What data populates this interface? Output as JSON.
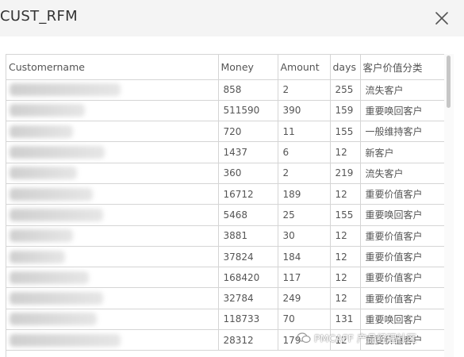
{
  "window": {
    "title": "CUST_RFM",
    "close_icon": "close-icon"
  },
  "table": {
    "headers": {
      "name": "Customername",
      "money": "Money",
      "amount": "Amount",
      "days": "days",
      "segment": "客户价值分类"
    },
    "rows": [
      {
        "money": "858",
        "amount": "2",
        "days": "255",
        "segment": "流失客户"
      },
      {
        "money": "511590",
        "amount": "390",
        "days": "159",
        "segment": "重要唤回客户"
      },
      {
        "money": "720",
        "amount": "11",
        "days": "155",
        "segment": "一般维持客户"
      },
      {
        "money": "1437",
        "amount": "6",
        "days": "12",
        "segment": "新客户"
      },
      {
        "money": "360",
        "amount": "2",
        "days": "219",
        "segment": "流失客户"
      },
      {
        "money": "16712",
        "amount": "189",
        "days": "12",
        "segment": "重要价值客户"
      },
      {
        "money": "5468",
        "amount": "25",
        "days": "155",
        "segment": "重要唤回客户"
      },
      {
        "money": "3881",
        "amount": "30",
        "days": "12",
        "segment": "重要价值客户"
      },
      {
        "money": "37824",
        "amount": "184",
        "days": "12",
        "segment": "重要价值客户"
      },
      {
        "money": "168420",
        "amount": "117",
        "days": "12",
        "segment": "重要价值客户"
      },
      {
        "money": "32784",
        "amount": "249",
        "days": "12",
        "segment": "重要价值客户"
      },
      {
        "money": "118733",
        "amount": "70",
        "days": "131",
        "segment": "重要唤回客户"
      },
      {
        "money": "28312",
        "amount": "179",
        "days": "12",
        "segment": "重要价值客户"
      }
    ]
  },
  "watermark": {
    "text": "PMCAFF 产品经理社区",
    "icon": "wechat-icon"
  }
}
